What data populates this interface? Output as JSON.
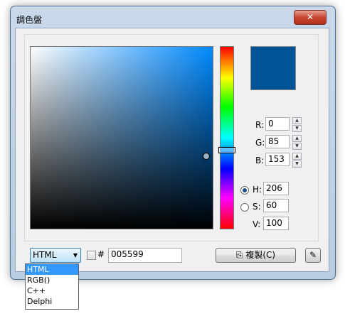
{
  "window": {
    "title": "調色盤",
    "close_label": "✕"
  },
  "color": {
    "preview_hex": "#005599"
  },
  "fields": {
    "r": {
      "label": "R:",
      "value": "0"
    },
    "g": {
      "label": "G:",
      "value": "85"
    },
    "b": {
      "label": "B:",
      "value": "153"
    },
    "h": {
      "label": "H:",
      "value": "206"
    },
    "s": {
      "label": "S:",
      "value": "60"
    },
    "v": {
      "label": "V:",
      "value": "100"
    }
  },
  "format": {
    "selected": "HTML",
    "options": [
      "HTML",
      "RGB()",
      "C++",
      "Delphi"
    ]
  },
  "hex": {
    "prefix": "#",
    "value": "005599"
  },
  "buttons": {
    "copy_label": "複製(C)",
    "copy_icon": "copy-icon",
    "picker_icon": "eyedropper-icon"
  },
  "icons": {
    "spin_up": "▲",
    "spin_down": "▼",
    "dropdown_arrow": "▼",
    "copy_glyph": "⎘",
    "picker_glyph": "✎"
  }
}
